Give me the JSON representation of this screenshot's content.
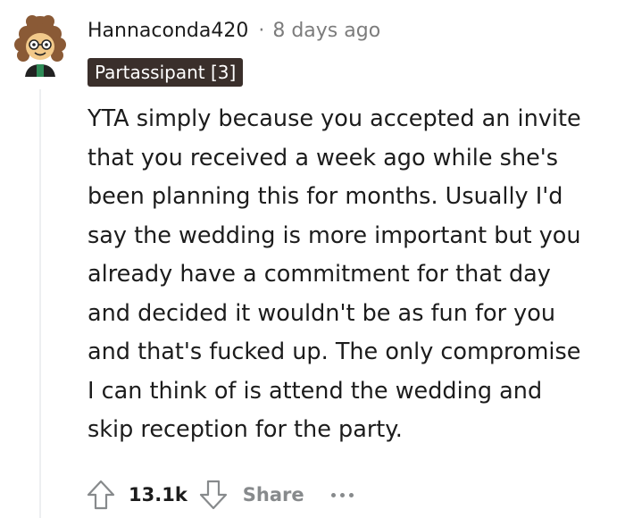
{
  "comment": {
    "username": "Hannaconda420",
    "separator": "·",
    "timestamp": "8 days ago",
    "flair": "Partassipant [3]",
    "body": "YTA simply because you accepted an invite\nthat you received a week ago while she's\nbeen planning this for months. Usually I'd\nsay the wedding is more important but you\nalready have a commitment for that day\nand decided it wouldn't be as fun for you\nand that's fucked up. The only compromise\nI can think of is attend the wedding and\nskip reception for the party."
  },
  "actions": {
    "upvote_icon": "arrow-up-outline-icon",
    "score": "13.1k",
    "downvote_icon": "arrow-down-outline-icon",
    "share_label": "Share",
    "more_icon": "ellipsis-icon"
  },
  "colors": {
    "text": "#1c1c1c",
    "muted": "#7c7c7c",
    "icon": "#878a8c",
    "flair_bg": "#3a2f2b",
    "flair_text": "#ffffff"
  }
}
